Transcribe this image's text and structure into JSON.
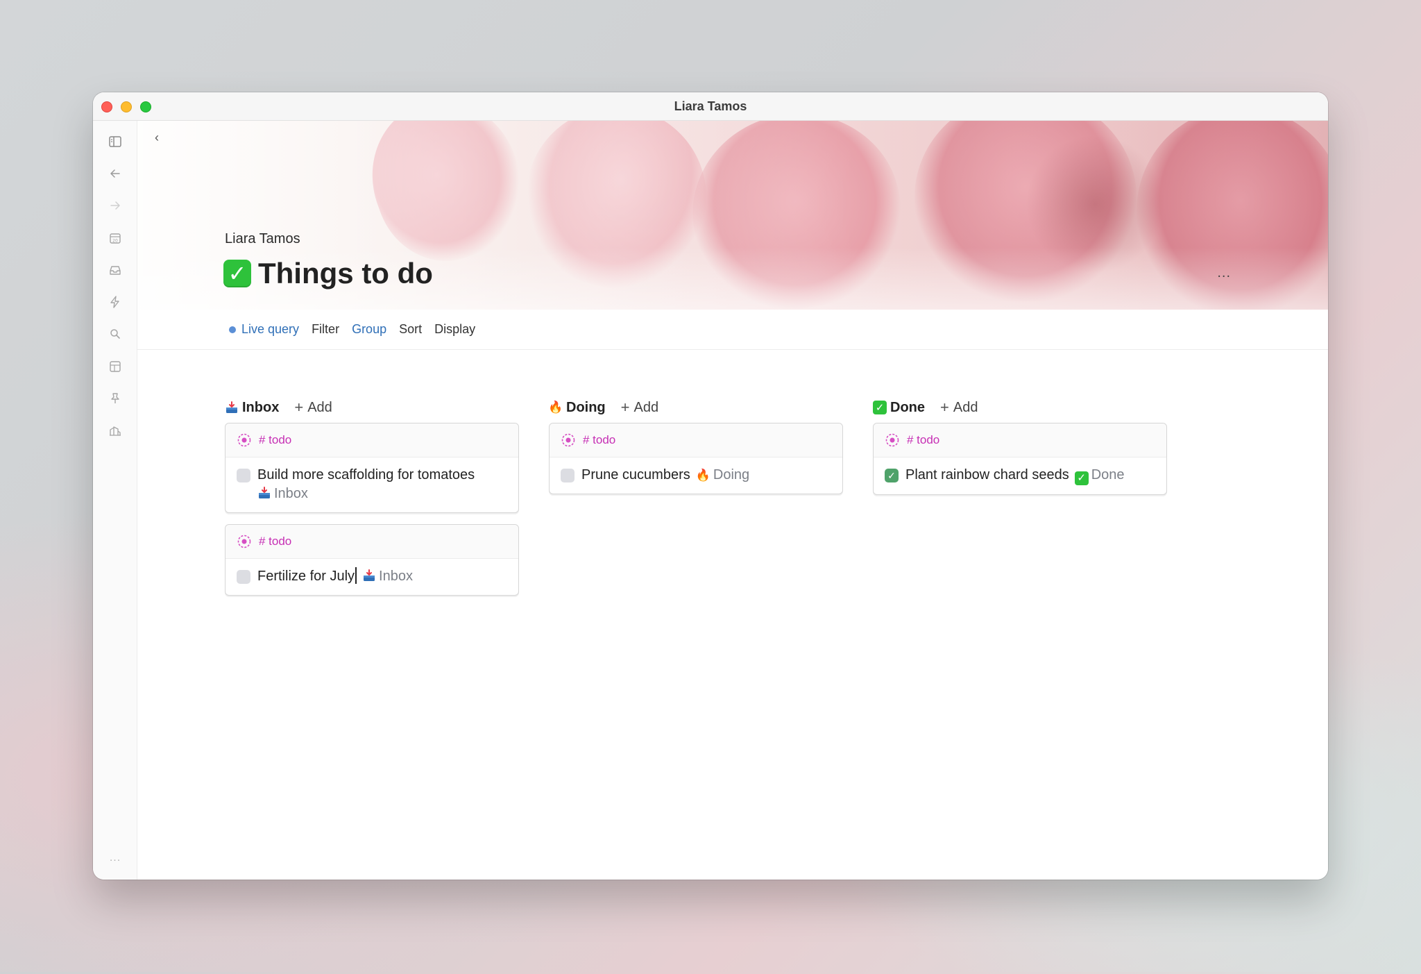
{
  "window": {
    "title": "Liara Tamos"
  },
  "sidebar": {
    "icons": [
      "sidebar-toggle-icon",
      "back-arrow-icon",
      "forward-arrow-icon",
      "calendar-icon",
      "inbox-tray-icon",
      "lightning-icon",
      "search-icon",
      "layout-icon",
      "pin-icon",
      "buildings-icon"
    ],
    "more": "..."
  },
  "page": {
    "breadcrumb": "Liara Tamos",
    "title": "Things to do",
    "title_emoji": "✅",
    "more": "..."
  },
  "toolbar": {
    "live_query": "Live query",
    "filter": "Filter",
    "group": "Group",
    "sort": "Sort",
    "display": "Display"
  },
  "board": {
    "add_label": "Add",
    "columns": [
      {
        "name": "Inbox",
        "emoji": "inbox-tray",
        "cards": [
          {
            "tag": "# todo",
            "text": "Build more scaffolding for tomatoes",
            "status": "Inbox",
            "done": false
          },
          {
            "tag": "# todo",
            "text": "Fertilize for July",
            "status": "Inbox",
            "done": false
          }
        ]
      },
      {
        "name": "Doing",
        "emoji": "🔥",
        "cards": [
          {
            "tag": "# todo",
            "text": "Prune cucumbers",
            "status": "Doing",
            "done": false
          }
        ]
      },
      {
        "name": "Done",
        "emoji": "✅",
        "cards": [
          {
            "tag": "# todo",
            "text": "Plant rainbow chard seeds",
            "status": "Done",
            "done": true
          }
        ]
      }
    ]
  },
  "colors": {
    "accent_blue": "#2f6fb7",
    "tag_magenta": "#c62fb4",
    "done_green": "#2ec23b"
  }
}
